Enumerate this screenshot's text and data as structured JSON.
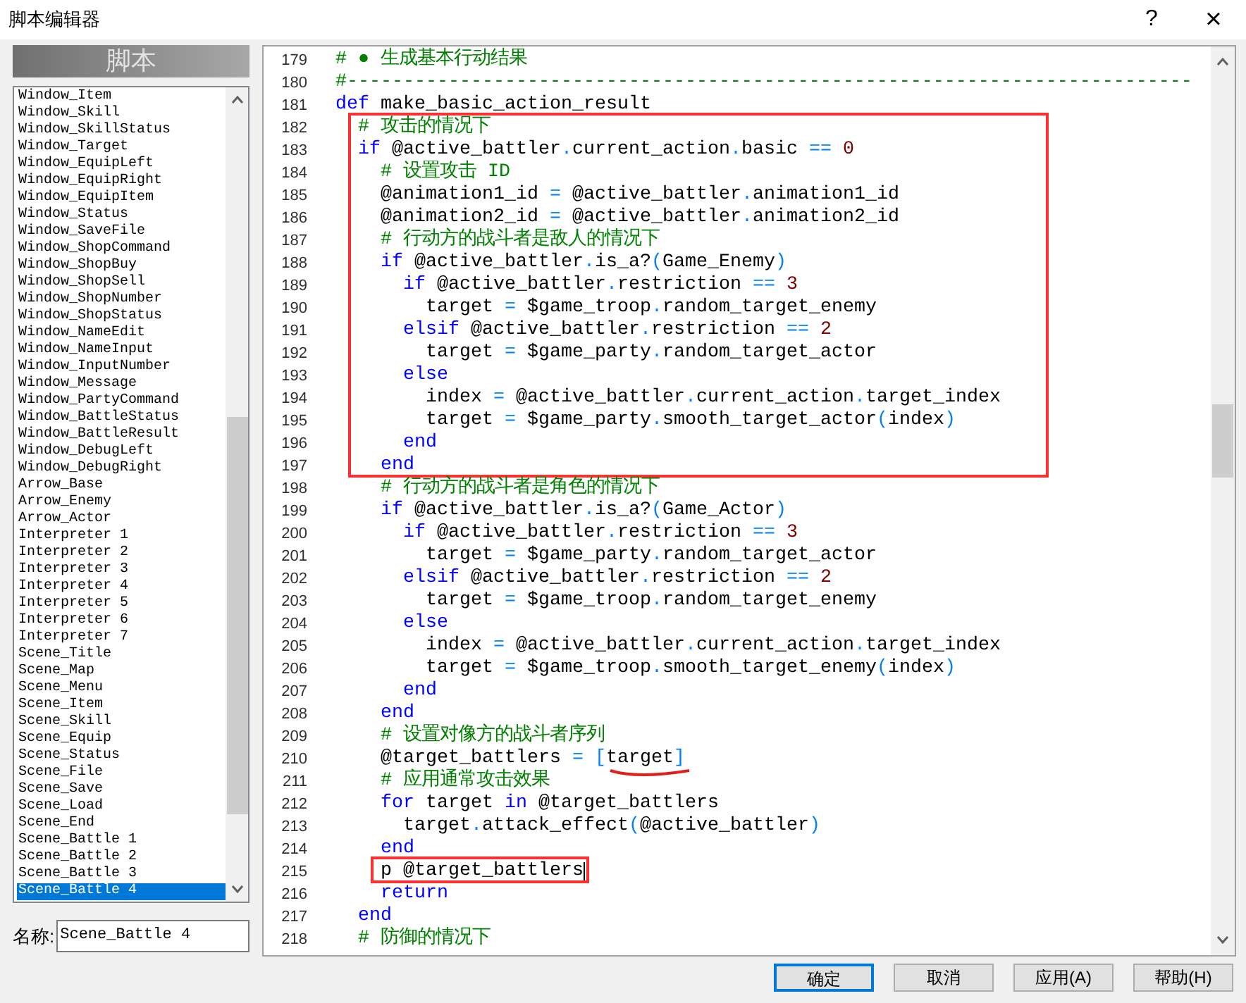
{
  "window": {
    "title": "脚本编辑器",
    "help": "?",
    "close": "×"
  },
  "script_list": {
    "header": "脚本",
    "items": [
      {
        "label": "Window_Item",
        "selected": false
      },
      {
        "label": "Window_Skill",
        "selected": false
      },
      {
        "label": "Window_SkillStatus",
        "selected": false
      },
      {
        "label": "Window_Target",
        "selected": false
      },
      {
        "label": "Window_EquipLeft",
        "selected": false
      },
      {
        "label": "Window_EquipRight",
        "selected": false
      },
      {
        "label": "Window_EquipItem",
        "selected": false
      },
      {
        "label": "Window_Status",
        "selected": false
      },
      {
        "label": "Window_SaveFile",
        "selected": false
      },
      {
        "label": "Window_ShopCommand",
        "selected": false
      },
      {
        "label": "Window_ShopBuy",
        "selected": false
      },
      {
        "label": "Window_ShopSell",
        "selected": false
      },
      {
        "label": "Window_ShopNumber",
        "selected": false
      },
      {
        "label": "Window_ShopStatus",
        "selected": false
      },
      {
        "label": "Window_NameEdit",
        "selected": false
      },
      {
        "label": "Window_NameInput",
        "selected": false
      },
      {
        "label": "Window_InputNumber",
        "selected": false
      },
      {
        "label": "Window_Message",
        "selected": false
      },
      {
        "label": "Window_PartyCommand",
        "selected": false
      },
      {
        "label": "Window_BattleStatus",
        "selected": false
      },
      {
        "label": "Window_BattleResult",
        "selected": false
      },
      {
        "label": "Window_DebugLeft",
        "selected": false
      },
      {
        "label": "Window_DebugRight",
        "selected": false
      },
      {
        "label": "Arrow_Base",
        "selected": false
      },
      {
        "label": "Arrow_Enemy",
        "selected": false
      },
      {
        "label": "Arrow_Actor",
        "selected": false
      },
      {
        "label": "Interpreter 1",
        "selected": false
      },
      {
        "label": "Interpreter 2",
        "selected": false
      },
      {
        "label": "Interpreter 3",
        "selected": false
      },
      {
        "label": "Interpreter 4",
        "selected": false
      },
      {
        "label": "Interpreter 5",
        "selected": false
      },
      {
        "label": "Interpreter 6",
        "selected": false
      },
      {
        "label": "Interpreter 7",
        "selected": false
      },
      {
        "label": "Scene_Title",
        "selected": false
      },
      {
        "label": "Scene_Map",
        "selected": false
      },
      {
        "label": "Scene_Menu",
        "selected": false
      },
      {
        "label": "Scene_Item",
        "selected": false
      },
      {
        "label": "Scene_Skill",
        "selected": false
      },
      {
        "label": "Scene_Equip",
        "selected": false
      },
      {
        "label": "Scene_Status",
        "selected": false
      },
      {
        "label": "Scene_File",
        "selected": false
      },
      {
        "label": "Scene_Save",
        "selected": false
      },
      {
        "label": "Scene_Load",
        "selected": false
      },
      {
        "label": "Scene_End",
        "selected": false
      },
      {
        "label": "Scene_Battle 1",
        "selected": false
      },
      {
        "label": "Scene_Battle 2",
        "selected": false
      },
      {
        "label": "Scene_Battle 3",
        "selected": false
      },
      {
        "label": "Scene_Battle 4",
        "selected": true
      }
    ],
    "name_label": "名称:",
    "name_value": "Scene_Battle 4"
  },
  "editor": {
    "blocks": [
      {
        "boxed": false,
        "lines": [
          {
            "no": "179",
            "caret": false,
            "segments": [
              {
                "kind": "comment",
                "text": "# ● 生成基本行动结果"
              }
            ]
          },
          {
            "no": "180",
            "caret": false,
            "segments": [
              {
                "kind": "comment",
                "text": "#---------------------------------------------------------------------------"
              }
            ]
          },
          {
            "no": "181",
            "caret": false,
            "segments": [
              {
                "kind": "keyword",
                "text": "def"
              },
              {
                "kind": "plain",
                "text": " make_basic_action_result"
              }
            ]
          }
        ]
      },
      {
        "boxed": true,
        "lines": [
          {
            "no": "182",
            "caret": false,
            "segments": [
              {
                "kind": "comment",
                "text": "  # 攻击的情况下"
              }
            ]
          },
          {
            "no": "183",
            "caret": false,
            "segments": [
              {
                "kind": "keyword",
                "text": "  if"
              },
              {
                "kind": "plain",
                "text": " @active_battler"
              },
              {
                "kind": "operator",
                "text": "."
              },
              {
                "kind": "plain",
                "text": "current_action"
              },
              {
                "kind": "operator",
                "text": "."
              },
              {
                "kind": "plain",
                "text": "basic "
              },
              {
                "kind": "operator",
                "text": "=="
              },
              {
                "kind": "number",
                "text": " 0"
              }
            ]
          },
          {
            "no": "184",
            "caret": false,
            "segments": [
              {
                "kind": "comment",
                "text": "    # 设置攻击 ID"
              }
            ]
          },
          {
            "no": "185",
            "caret": false,
            "segments": [
              {
                "kind": "plain",
                "text": "    @animation1_id "
              },
              {
                "kind": "operator",
                "text": "="
              },
              {
                "kind": "plain",
                "text": " @active_battler"
              },
              {
                "kind": "operator",
                "text": "."
              },
              {
                "kind": "plain",
                "text": "animation1_id"
              }
            ]
          },
          {
            "no": "186",
            "caret": false,
            "segments": [
              {
                "kind": "plain",
                "text": "    @animation2_id "
              },
              {
                "kind": "operator",
                "text": "="
              },
              {
                "kind": "plain",
                "text": " @active_battler"
              },
              {
                "kind": "operator",
                "text": "."
              },
              {
                "kind": "plain",
                "text": "animation2_id"
              }
            ]
          },
          {
            "no": "187",
            "caret": false,
            "segments": [
              {
                "kind": "comment",
                "text": "    # 行动方的战斗者是敌人的情况下"
              }
            ]
          },
          {
            "no": "188",
            "caret": false,
            "segments": [
              {
                "kind": "keyword",
                "text": "    if"
              },
              {
                "kind": "plain",
                "text": " @active_battler"
              },
              {
                "kind": "operator",
                "text": "."
              },
              {
                "kind": "plain",
                "text": "is_a?"
              },
              {
                "kind": "operator",
                "text": "("
              },
              {
                "kind": "plain",
                "text": "Game_Enemy"
              },
              {
                "kind": "operator",
                "text": ")"
              }
            ]
          },
          {
            "no": "189",
            "caret": false,
            "segments": [
              {
                "kind": "keyword",
                "text": "      if"
              },
              {
                "kind": "plain",
                "text": " @active_battler"
              },
              {
                "kind": "operator",
                "text": "."
              },
              {
                "kind": "plain",
                "text": "restriction "
              },
              {
                "kind": "operator",
                "text": "=="
              },
              {
                "kind": "number",
                "text": " 3"
              }
            ]
          },
          {
            "no": "190",
            "caret": false,
            "segments": [
              {
                "kind": "plain",
                "text": "        target "
              },
              {
                "kind": "operator",
                "text": "="
              },
              {
                "kind": "plain",
                "text": " $game_troop"
              },
              {
                "kind": "operator",
                "text": "."
              },
              {
                "kind": "plain",
                "text": "random_target_enemy"
              }
            ]
          },
          {
            "no": "191",
            "caret": false,
            "segments": [
              {
                "kind": "keyword",
                "text": "      elsif"
              },
              {
                "kind": "plain",
                "text": " @active_battler"
              },
              {
                "kind": "operator",
                "text": "."
              },
              {
                "kind": "plain",
                "text": "restriction "
              },
              {
                "kind": "operator",
                "text": "=="
              },
              {
                "kind": "number",
                "text": " 2"
              }
            ]
          },
          {
            "no": "192",
            "caret": false,
            "segments": [
              {
                "kind": "plain",
                "text": "        target "
              },
              {
                "kind": "operator",
                "text": "="
              },
              {
                "kind": "plain",
                "text": " $game_party"
              },
              {
                "kind": "operator",
                "text": "."
              },
              {
                "kind": "plain",
                "text": "random_target_actor"
              }
            ]
          },
          {
            "no": "193",
            "caret": false,
            "segments": [
              {
                "kind": "keyword",
                "text": "      else"
              }
            ]
          },
          {
            "no": "194",
            "caret": false,
            "segments": [
              {
                "kind": "plain",
                "text": "        index "
              },
              {
                "kind": "operator",
                "text": "="
              },
              {
                "kind": "plain",
                "text": " @active_battler"
              },
              {
                "kind": "operator",
                "text": "."
              },
              {
                "kind": "plain",
                "text": "current_action"
              },
              {
                "kind": "operator",
                "text": "."
              },
              {
                "kind": "plain",
                "text": "target_index"
              }
            ]
          },
          {
            "no": "195",
            "caret": false,
            "segments": [
              {
                "kind": "plain",
                "text": "        target "
              },
              {
                "kind": "operator",
                "text": "="
              },
              {
                "kind": "plain",
                "text": " $game_party"
              },
              {
                "kind": "operator",
                "text": "."
              },
              {
                "kind": "plain",
                "text": "smooth_target_actor"
              },
              {
                "kind": "operator",
                "text": "("
              },
              {
                "kind": "plain",
                "text": "index"
              },
              {
                "kind": "operator",
                "text": ")"
              }
            ]
          },
          {
            "no": "196",
            "caret": false,
            "segments": [
              {
                "kind": "keyword",
                "text": "      end"
              }
            ]
          },
          {
            "no": "197",
            "caret": false,
            "segments": [
              {
                "kind": "keyword",
                "text": "    end"
              }
            ]
          }
        ]
      },
      {
        "boxed": false,
        "lines": [
          {
            "no": "198",
            "caret": false,
            "segments": [
              {
                "kind": "comment",
                "text": "    # 行动方的战斗者是角色的情况下"
              }
            ]
          },
          {
            "no": "199",
            "caret": false,
            "segments": [
              {
                "kind": "keyword",
                "text": "    if"
              },
              {
                "kind": "plain",
                "text": " @active_battler"
              },
              {
                "kind": "operator",
                "text": "."
              },
              {
                "kind": "plain",
                "text": "is_a?"
              },
              {
                "kind": "operator",
                "text": "("
              },
              {
                "kind": "plain",
                "text": "Game_Actor"
              },
              {
                "kind": "operator",
                "text": ")"
              }
            ]
          },
          {
            "no": "200",
            "caret": false,
            "segments": [
              {
                "kind": "keyword",
                "text": "      if"
              },
              {
                "kind": "plain",
                "text": " @active_battler"
              },
              {
                "kind": "operator",
                "text": "."
              },
              {
                "kind": "plain",
                "text": "restriction "
              },
              {
                "kind": "operator",
                "text": "=="
              },
              {
                "kind": "number",
                "text": " 3"
              }
            ]
          },
          {
            "no": "201",
            "caret": false,
            "segments": [
              {
                "kind": "plain",
                "text": "        target "
              },
              {
                "kind": "operator",
                "text": "="
              },
              {
                "kind": "plain",
                "text": " $game_party"
              },
              {
                "kind": "operator",
                "text": "."
              },
              {
                "kind": "plain",
                "text": "random_target_actor"
              }
            ]
          },
          {
            "no": "202",
            "caret": false,
            "segments": [
              {
                "kind": "keyword",
                "text": "      elsif"
              },
              {
                "kind": "plain",
                "text": " @active_battler"
              },
              {
                "kind": "operator",
                "text": "."
              },
              {
                "kind": "plain",
                "text": "restriction "
              },
              {
                "kind": "operator",
                "text": "=="
              },
              {
                "kind": "number",
                "text": " 2"
              }
            ]
          },
          {
            "no": "203",
            "caret": false,
            "segments": [
              {
                "kind": "plain",
                "text": "        target "
              },
              {
                "kind": "operator",
                "text": "="
              },
              {
                "kind": "plain",
                "text": " $game_troop"
              },
              {
                "kind": "operator",
                "text": "."
              },
              {
                "kind": "plain",
                "text": "random_target_enemy"
              }
            ]
          },
          {
            "no": "204",
            "caret": false,
            "segments": [
              {
                "kind": "keyword",
                "text": "      else"
              }
            ]
          },
          {
            "no": "205",
            "caret": false,
            "segments": [
              {
                "kind": "plain",
                "text": "        index "
              },
              {
                "kind": "operator",
                "text": "="
              },
              {
                "kind": "plain",
                "text": " @active_battler"
              },
              {
                "kind": "operator",
                "text": "."
              },
              {
                "kind": "plain",
                "text": "current_action"
              },
              {
                "kind": "operator",
                "text": "."
              },
              {
                "kind": "plain",
                "text": "target_index"
              }
            ]
          },
          {
            "no": "206",
            "caret": false,
            "segments": [
              {
                "kind": "plain",
                "text": "        target "
              },
              {
                "kind": "operator",
                "text": "="
              },
              {
                "kind": "plain",
                "text": " $game_troop"
              },
              {
                "kind": "operator",
                "text": "."
              },
              {
                "kind": "plain",
                "text": "smooth_target_enemy"
              },
              {
                "kind": "operator",
                "text": "("
              },
              {
                "kind": "plain",
                "text": "index"
              },
              {
                "kind": "operator",
                "text": ")"
              }
            ]
          },
          {
            "no": "207",
            "caret": false,
            "segments": [
              {
                "kind": "keyword",
                "text": "      end"
              }
            ]
          },
          {
            "no": "208",
            "caret": false,
            "segments": [
              {
                "kind": "keyword",
                "text": "    end"
              }
            ]
          },
          {
            "no": "209",
            "caret": false,
            "segments": [
              {
                "kind": "comment",
                "text": "    # 设置对像方的战斗者序列"
              }
            ]
          },
          {
            "no": "210",
            "caret": false,
            "segments": [
              {
                "kind": "plain",
                "text": "    @target_battlers "
              },
              {
                "kind": "operator",
                "text": "= ["
              },
              {
                "kind": "plain",
                "text": "target",
                "underlined": true
              },
              {
                "kind": "operator",
                "text": "]"
              }
            ]
          },
          {
            "no": "211",
            "caret": false,
            "segments": [
              {
                "kind": "comment",
                "text": "    # 应用通常攻击效果"
              }
            ]
          },
          {
            "no": "212",
            "caret": false,
            "segments": [
              {
                "kind": "keyword",
                "text": "    for"
              },
              {
                "kind": "plain",
                "text": " target "
              },
              {
                "kind": "keyword",
                "text": "in"
              },
              {
                "kind": "plain",
                "text": " @target_battlers"
              }
            ]
          },
          {
            "no": "213",
            "caret": false,
            "segments": [
              {
                "kind": "plain",
                "text": "      target"
              },
              {
                "kind": "operator",
                "text": "."
              },
              {
                "kind": "plain",
                "text": "attack_effect"
              },
              {
                "kind": "operator",
                "text": "("
              },
              {
                "kind": "plain",
                "text": "@active_battler"
              },
              {
                "kind": "operator",
                "text": ")"
              }
            ]
          },
          {
            "no": "214",
            "caret": false,
            "segments": [
              {
                "kind": "keyword",
                "text": "    end"
              }
            ]
          }
        ]
      },
      {
        "boxed": true,
        "lines": [
          {
            "no": "215",
            "caret": true,
            "segments": [
              {
                "kind": "plain",
                "text": "    p @target_battlers"
              }
            ]
          }
        ]
      },
      {
        "boxed": false,
        "lines": [
          {
            "no": "216",
            "caret": false,
            "segments": [
              {
                "kind": "keyword",
                "text": "    return"
              }
            ]
          },
          {
            "no": "217",
            "caret": false,
            "segments": [
              {
                "kind": "keyword",
                "text": "  end"
              }
            ]
          },
          {
            "no": "218",
            "caret": false,
            "segments": [
              {
                "kind": "comment",
                "text": "  # 防御的情况下"
              }
            ]
          }
        ]
      }
    ]
  },
  "buttons": [
    {
      "label": "确定",
      "default": true
    },
    {
      "label": "取消",
      "default": false
    },
    {
      "label": "应用(A)",
      "default": false
    },
    {
      "label": "帮助(H)",
      "default": false
    }
  ]
}
